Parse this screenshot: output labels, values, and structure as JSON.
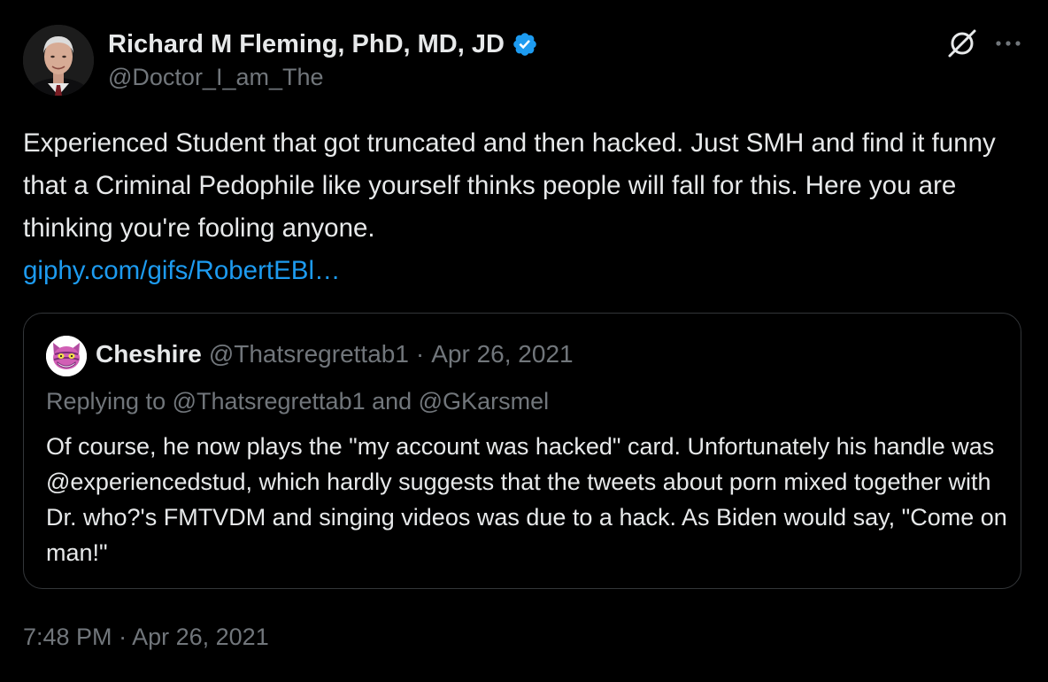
{
  "author": {
    "name": "Richard M Fleming, PhD, MD, JD",
    "handle": "@Doctor_I_am_The",
    "verified": true
  },
  "tweet": {
    "text": "Experienced Student that got truncated and then hacked. Just SMH and find it funny that a Criminal Pedophile like yourself thinks people will fall for this. Here you are thinking you're fooling anyone.",
    "link": "giphy.com/gifs/RobertEBl…"
  },
  "quote": {
    "name": "Cheshire",
    "handle": "@Thatsregrettab1",
    "separator": "·",
    "date": "Apr 26, 2021",
    "replying_to": "Replying to @Thatsregrettab1 and @GKarsmel",
    "text": "Of course, he now plays the \"my account was hacked\" card. Unfortunately his handle was @experiencedstud, which hardly suggests that the tweets about porn mixed together with Dr. who?'s FMTVDM and singing videos was due to a hack. As Biden would say, \"Come on man!\""
  },
  "timestamp": {
    "time": "7:48 PM",
    "separator": "·",
    "date": "Apr 26, 2021"
  },
  "icons": {
    "grok": "grok-icon",
    "more": "more-icon",
    "verified": "verified-badge-icon"
  },
  "colors": {
    "background": "#000000",
    "text": "#e7e9ea",
    "secondary": "#71767b",
    "link": "#1d9bf0",
    "border": "#333639",
    "verified": "#1d9bf0"
  }
}
